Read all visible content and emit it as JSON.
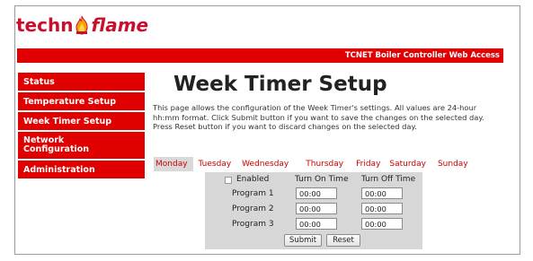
{
  "brand": {
    "logo_prefix": "techn",
    "logo_suffix": "flame",
    "header_text": "TCNET Boiler Controller Web Access"
  },
  "sidebar": {
    "items": [
      {
        "label": "Status"
      },
      {
        "label": "Temperature Setup"
      },
      {
        "label": "Week Timer Setup"
      },
      {
        "label": "Network Configuration"
      },
      {
        "label": "Administration"
      }
    ]
  },
  "page": {
    "title": "Week Timer Setup",
    "description": "This page allows the configuration of the Week Timer's settings. All values are 24-hour hh:mm format. Click Submit button if you want to save the changes on the selected day. Press Reset button if you want to discard changes on the selected day."
  },
  "tabs": [
    "Monday",
    "Tuesday",
    "Wednesday",
    "Thursday",
    "Friday",
    "Saturday",
    "Sunday"
  ],
  "timer": {
    "enabled_label": "Enabled",
    "enabled_checked": false,
    "col_on": "Turn On Time",
    "col_off": "Turn Off Time",
    "programs": [
      {
        "label": "Program 1",
        "on": "00:00",
        "off": "00:00"
      },
      {
        "label": "Program 2",
        "on": "00:00",
        "off": "00:00"
      },
      {
        "label": "Program 3",
        "on": "00:00",
        "off": "00:00"
      }
    ]
  },
  "buttons": {
    "submit": "Submit",
    "reset": "Reset"
  },
  "colors": {
    "brand_red": "#e00000",
    "tab_text": "#cc0000",
    "panel_gray": "#d7d7d7"
  }
}
